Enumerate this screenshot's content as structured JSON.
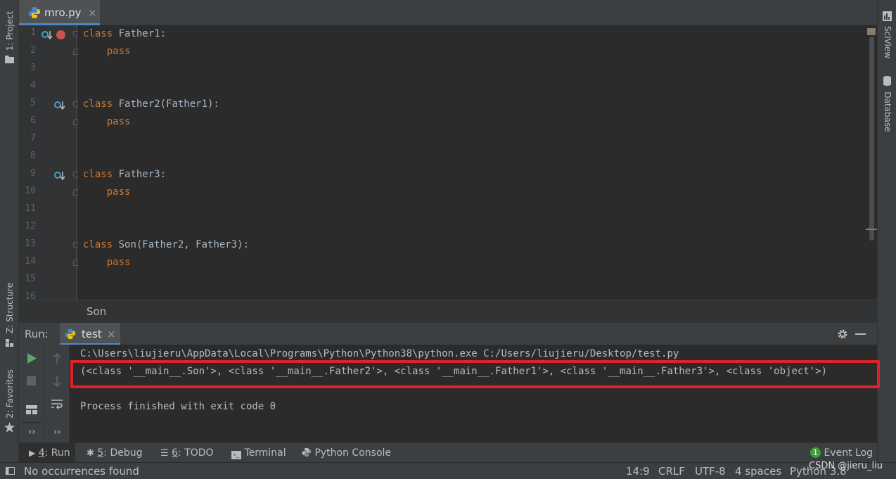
{
  "window": {
    "file_tab_label": "mro.py",
    "file_tab_close": "×"
  },
  "left_tool_tabs": {
    "project": "1: Project",
    "structure": "Z: Structure",
    "favorites": "2: Favorites"
  },
  "right_tool_tabs": {
    "sciview": "SciView",
    "database": "Database"
  },
  "editor": {
    "line_numbers": [
      "1",
      "2",
      "3",
      "4",
      "5",
      "6",
      "7",
      "8",
      "9",
      "10",
      "11",
      "12",
      "13",
      "14",
      "15",
      "16"
    ],
    "lines": [
      {
        "kw": "class",
        "rest": " Father1:"
      },
      {
        "kw": "    pass",
        "rest": ""
      },
      {
        "kw": "",
        "rest": ""
      },
      {
        "kw": "",
        "rest": ""
      },
      {
        "kw": "class",
        "rest": " Father2(Father1):"
      },
      {
        "kw": "    pass",
        "rest": ""
      },
      {
        "kw": "",
        "rest": ""
      },
      {
        "kw": "",
        "rest": ""
      },
      {
        "kw": "class",
        "rest": " Father3:"
      },
      {
        "kw": "    pass",
        "rest": ""
      },
      {
        "kw": "",
        "rest": ""
      },
      {
        "kw": "",
        "rest": ""
      },
      {
        "kw": "class",
        "rest": " Son(Father2, Father3):"
      },
      {
        "kw": "    pass",
        "rest": ""
      },
      {
        "kw": "",
        "rest": ""
      },
      {
        "kw": "",
        "rest": ""
      }
    ],
    "breadcrumb": "Son"
  },
  "run_panel": {
    "label": "Run:",
    "tab_label": "test",
    "tab_close": "×",
    "console_lines": [
      "C:\\Users\\liujieru\\AppData\\Local\\Programs\\Python\\Python38\\python.exe C:/Users/liujieru/Desktop/test.py",
      "(<class '__main__.Son'>, <class '__main__.Father2'>, <class '__main__.Father1'>, <class '__main__.Father3'>, <class 'object'>)",
      "",
      "Process finished with exit code 0"
    ]
  },
  "bottom_tabs": {
    "run_num": "4",
    "run_label": ": Run",
    "debug_num": "5",
    "debug_label": ": Debug",
    "todo_num": "6",
    "todo_label": ": TODO",
    "terminal": "Terminal",
    "python_console": "Python Console",
    "event_log_count": "1",
    "event_log": "Event Log"
  },
  "status_bar": {
    "message": "No occurrences found",
    "position": "14:9",
    "line_sep": "CRLF",
    "encoding": "UTF-8",
    "indent": "4 spaces",
    "interpreter": "Python 3.8",
    "watermark": "CSDN @jieru_liu"
  },
  "colors": {
    "accent": "#4a88c7",
    "breakpoint": "#c75450",
    "highlight_box": "#e0212b",
    "keyword": "#cc7832"
  }
}
